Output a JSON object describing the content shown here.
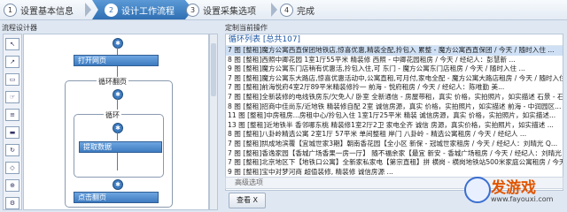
{
  "wizard": {
    "steps": [
      {
        "num": "1",
        "label": "设置基本信息"
      },
      {
        "num": "2",
        "label": "设计工作流程"
      },
      {
        "num": "3",
        "label": "设置采集选项"
      },
      {
        "num": "4",
        "label": "完成"
      }
    ],
    "active_step": 2
  },
  "left_panel": {
    "title": "流程设计器"
  },
  "flow": {
    "open_page": "打开网页",
    "loop_page": "循环翻页",
    "loop": "循环",
    "extract": "提取数据",
    "click_next": "点击翻页"
  },
  "right_panel": {
    "title": "定制当前操作",
    "list_header": "循环列表 [总共107]",
    "rows": [
      "7 图 [整租]魔方公寓西直保团地铁店,惊喜优惠,精装全配,拎包入 累整 - 魔方公寓西直保团 / 今天 / 随时入住 ...",
      "8 图 [整租]西照中卿花园 1室1厅55平米 精装修 西照 - 中卿花园租房 / 今天 / 经纪人：彭慧新 ...",
      "9 图 [整租]魔方公寓东门店稍有优惠活,拎包入住,可 东门 - 魔方公寓东门店租房 / 今天 / 随时入住 ...",
      "7 图 [整租]魔方公寓东大路店,惊喜优惠活动中,公寓直租,可月付,家电全配 - 魔方公寓大路店租房 / 今天 / 随时入住 ...",
      "7 图 [整租]前海悦府4室2厅89平米精装修拎一 前海 - 悦府租房 / 今天 / 经纪人：陈唯勤 美...",
      "7 图 [整租]全新装修的电线铁房东/欠免人/ 卧室 全新通信 - 房屋带租，真实 价格，实拍照片，如实描述 石景 - 石景石院租房...",
      "8 图 [整租]招商中佳尚东/近地铁 精装修自配 2室 诚信房源，真实 价格，实拍照片，如实描述 前海 - 中润园区...",
      "11 图 [整租]中房租房...房租中心/拎包入住 1室1厅25平米 精装 诚信房源，真实 价格，实拍照片，如实描述...",
      "13 图 [整租]近地铁半 香邻哪东桃 精装修1室2厅2卫 家电全齐 诚信 房源，真实价格，实拍照片，如实描述 ...",
      "8 图 [整租]八卦岭精选公寓 2室1厅 57平米 单间整租 岸门 八卦岭 - 精选公寓租房 / 今天 / 经纪人 ...",
      "7 图 [整租]拱成地滨覆【宜城世家3期】朝南香花园【全小区 新保 - 冠城世家租房 / 今天 / 经纪人：刘晴光 Q...",
      "7 图 [整租]香逸家园【香城广场香果一房一厅】 随不福余家【最宜 新安 - 香城广场租房 / 今天 / 经纪人：刘晴光 Q...",
      "7 图 [整租]北京地区下【地铁口公寓】全新家私家电【第宗直租】拼 横岗 - 横岗地铁站500米家庭公寓租房 / 今天...",
      "9 图 [整租]宝中对梦河商 超值装修, 精装修 诚信房源 ..."
    ],
    "selected_row": 0,
    "advanced_label": "高级选项",
    "bottom_button": "查看 X"
  },
  "watermark": {
    "brand": "发游戏",
    "url": "www.fayouxi.com"
  }
}
